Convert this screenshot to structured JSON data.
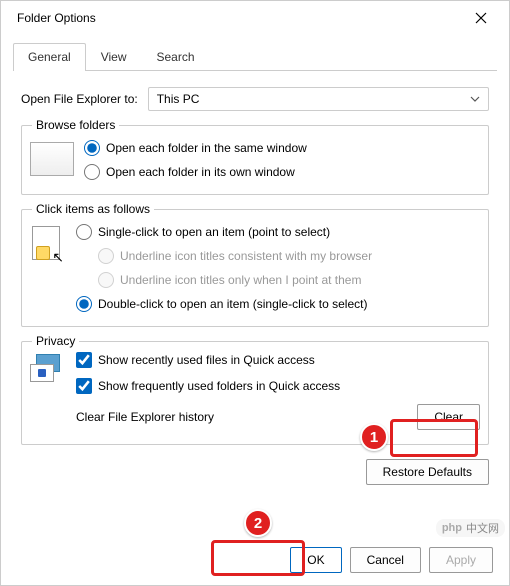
{
  "window": {
    "title": "Folder Options"
  },
  "tabs": {
    "general": "General",
    "view": "View",
    "search": "Search"
  },
  "open": {
    "label": "Open File Explorer to:",
    "value": "This PC"
  },
  "browse": {
    "legend": "Browse folders",
    "same": "Open each folder in the same window",
    "own": "Open each folder in its own window"
  },
  "click": {
    "legend": "Click items as follows",
    "single": "Single-click to open an item (point to select)",
    "underline_browser": "Underline icon titles consistent with my browser",
    "underline_point": "Underline icon titles only when I point at them",
    "double": "Double-click to open an item (single-click to select)"
  },
  "privacy": {
    "legend": "Privacy",
    "recent": "Show recently used files in Quick access",
    "frequent": "Show frequently used folders in Quick access",
    "clear_label": "Clear File Explorer history",
    "clear_btn": "Clear"
  },
  "restore": "Restore Defaults",
  "buttons": {
    "ok": "OK",
    "cancel": "Cancel",
    "apply": "Apply"
  },
  "annotations": {
    "b1": "1",
    "b2": "2"
  },
  "watermark": {
    "logo": "php",
    "text": "中文网"
  }
}
